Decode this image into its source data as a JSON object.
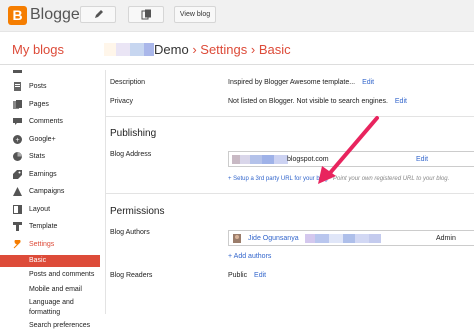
{
  "topbar": {
    "brand": "Blogger",
    "view_blog": "View blog"
  },
  "header": {
    "my_blogs": "My blogs",
    "blog_name_suffix": "Demo",
    "separator": "›",
    "settings": "Settings",
    "basic": "Basic"
  },
  "sidebar": {
    "items": [
      {
        "label": "Posts",
        "icon": "posts-icon"
      },
      {
        "label": "Pages",
        "icon": "pages-icon"
      },
      {
        "label": "Comments",
        "icon": "comments-icon"
      },
      {
        "label": "Google+",
        "icon": "google-plus-icon"
      },
      {
        "label": "Stats",
        "icon": "stats-icon"
      },
      {
        "label": "Earnings",
        "icon": "earnings-icon"
      },
      {
        "label": "Campaigns",
        "icon": "campaigns-icon"
      },
      {
        "label": "Layout",
        "icon": "layout-icon"
      },
      {
        "label": "Template",
        "icon": "template-icon"
      },
      {
        "label": "Settings",
        "icon": "wrench-icon"
      }
    ],
    "sub_items": [
      {
        "label": "Basic"
      },
      {
        "label": "Posts and comments"
      },
      {
        "label": "Mobile and email"
      },
      {
        "label": "Language and"
      },
      {
        "label": "formatting"
      },
      {
        "label": "Search preferences"
      }
    ]
  },
  "settings": {
    "description": {
      "label": "Description",
      "value": "Inspired by Blogger Awesome template...",
      "edit": "Edit"
    },
    "privacy": {
      "label": "Privacy",
      "value": "Not listed on Blogger. Not visible to search engines.",
      "edit": "Edit"
    },
    "publishing": {
      "title": "Publishing",
      "blog_address_label": "Blog Address",
      "address_suffix": "blogspot.com",
      "edit": "Edit",
      "custom_domain_link": "+ Setup a 3rd party URL for your blog",
      "custom_domain_hint": "- Point your own registered URL to your blog."
    },
    "permissions": {
      "title": "Permissions",
      "authors_label": "Blog Authors",
      "author_name": "Jide Ogunsanya",
      "author_role": "Admin",
      "add_authors": "+ Add authors",
      "readers_label": "Blog Readers",
      "readers_value": "Public",
      "edit": "Edit"
    }
  },
  "colors": {
    "accent": "#dd4b39",
    "link": "#3366cc",
    "arrow": "#e8245e",
    "logo": "#f57d00"
  }
}
